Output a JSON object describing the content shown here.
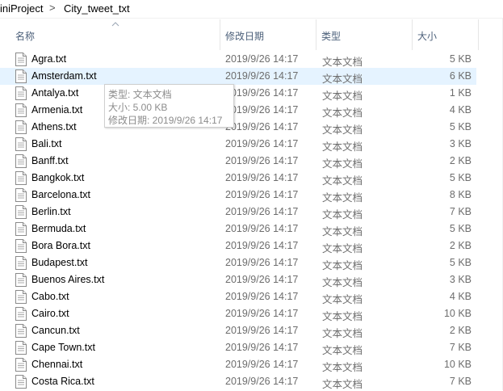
{
  "breadcrumb": {
    "items": [
      "iniProject",
      "City_tweet_txt"
    ],
    "separator": ">"
  },
  "columns": {
    "name": "名称",
    "date": "修改日期",
    "type": "类型",
    "size": "大小"
  },
  "files": [
    {
      "name": "Agra.txt",
      "date": "2019/9/26 14:17",
      "type": "文本文档",
      "size": "5 KB"
    },
    {
      "name": "Amsterdam.txt",
      "date": "2019/9/26 14:17",
      "type": "文本文档",
      "size": "6 KB"
    },
    {
      "name": "Antalya.txt",
      "date": "2019/9/26 14:17",
      "type": "文本文档",
      "size": "1 KB"
    },
    {
      "name": "Armenia.txt",
      "date": "2019/9/26 14:17",
      "type": "文本文档",
      "size": "4 KB"
    },
    {
      "name": "Athens.txt",
      "date": "2019/9/26 14:17",
      "type": "文本文档",
      "size": "5 KB"
    },
    {
      "name": "Bali.txt",
      "date": "2019/9/26 14:17",
      "type": "文本文档",
      "size": "3 KB"
    },
    {
      "name": "Banff.txt",
      "date": "2019/9/26 14:17",
      "type": "文本文档",
      "size": "2 KB"
    },
    {
      "name": "Bangkok.txt",
      "date": "2019/9/26 14:17",
      "type": "文本文档",
      "size": "5 KB"
    },
    {
      "name": "Barcelona.txt",
      "date": "2019/9/26 14:17",
      "type": "文本文档",
      "size": "8 KB"
    },
    {
      "name": "Berlin.txt",
      "date": "2019/9/26 14:17",
      "type": "文本文档",
      "size": "7 KB"
    },
    {
      "name": "Bermuda.txt",
      "date": "2019/9/26 14:17",
      "type": "文本文档",
      "size": "5 KB"
    },
    {
      "name": "Bora Bora.txt",
      "date": "2019/9/26 14:17",
      "type": "文本文档",
      "size": "2 KB"
    },
    {
      "name": "Budapest.txt",
      "date": "2019/9/26 14:17",
      "type": "文本文档",
      "size": "5 KB"
    },
    {
      "name": "Buenos Aires.txt",
      "date": "2019/9/26 14:17",
      "type": "文本文档",
      "size": "3 KB"
    },
    {
      "name": "Cabo.txt",
      "date": "2019/9/26 14:17",
      "type": "文本文档",
      "size": "4 KB"
    },
    {
      "name": "Cairo.txt",
      "date": "2019/9/26 14:17",
      "type": "文本文档",
      "size": "10 KB"
    },
    {
      "name": "Cancun.txt",
      "date": "2019/9/26 14:17",
      "type": "文本文档",
      "size": "2 KB"
    },
    {
      "name": "Cape Town.txt",
      "date": "2019/9/26 14:17",
      "type": "文本文档",
      "size": "7 KB"
    },
    {
      "name": "Chennai.txt",
      "date": "2019/9/26 14:17",
      "type": "文本文档",
      "size": "10 KB"
    },
    {
      "name": "Costa Rica.txt",
      "date": "2019/9/26 14:17",
      "type": "文本文档",
      "size": "7 KB"
    }
  ],
  "hovered_index": 1,
  "tooltip": {
    "type_line": "类型: 文本文档",
    "size_line": "大小: 5.00 KB",
    "date_line": "修改日期: 2019/9/26 14:17"
  },
  "colors": {
    "hover_row": "#e5f3ff",
    "header_text": "#4c607a",
    "detail_text": "#6d6d6d"
  },
  "icons": {
    "file": "text-file-icon",
    "sort": "sort-ascending-icon"
  }
}
